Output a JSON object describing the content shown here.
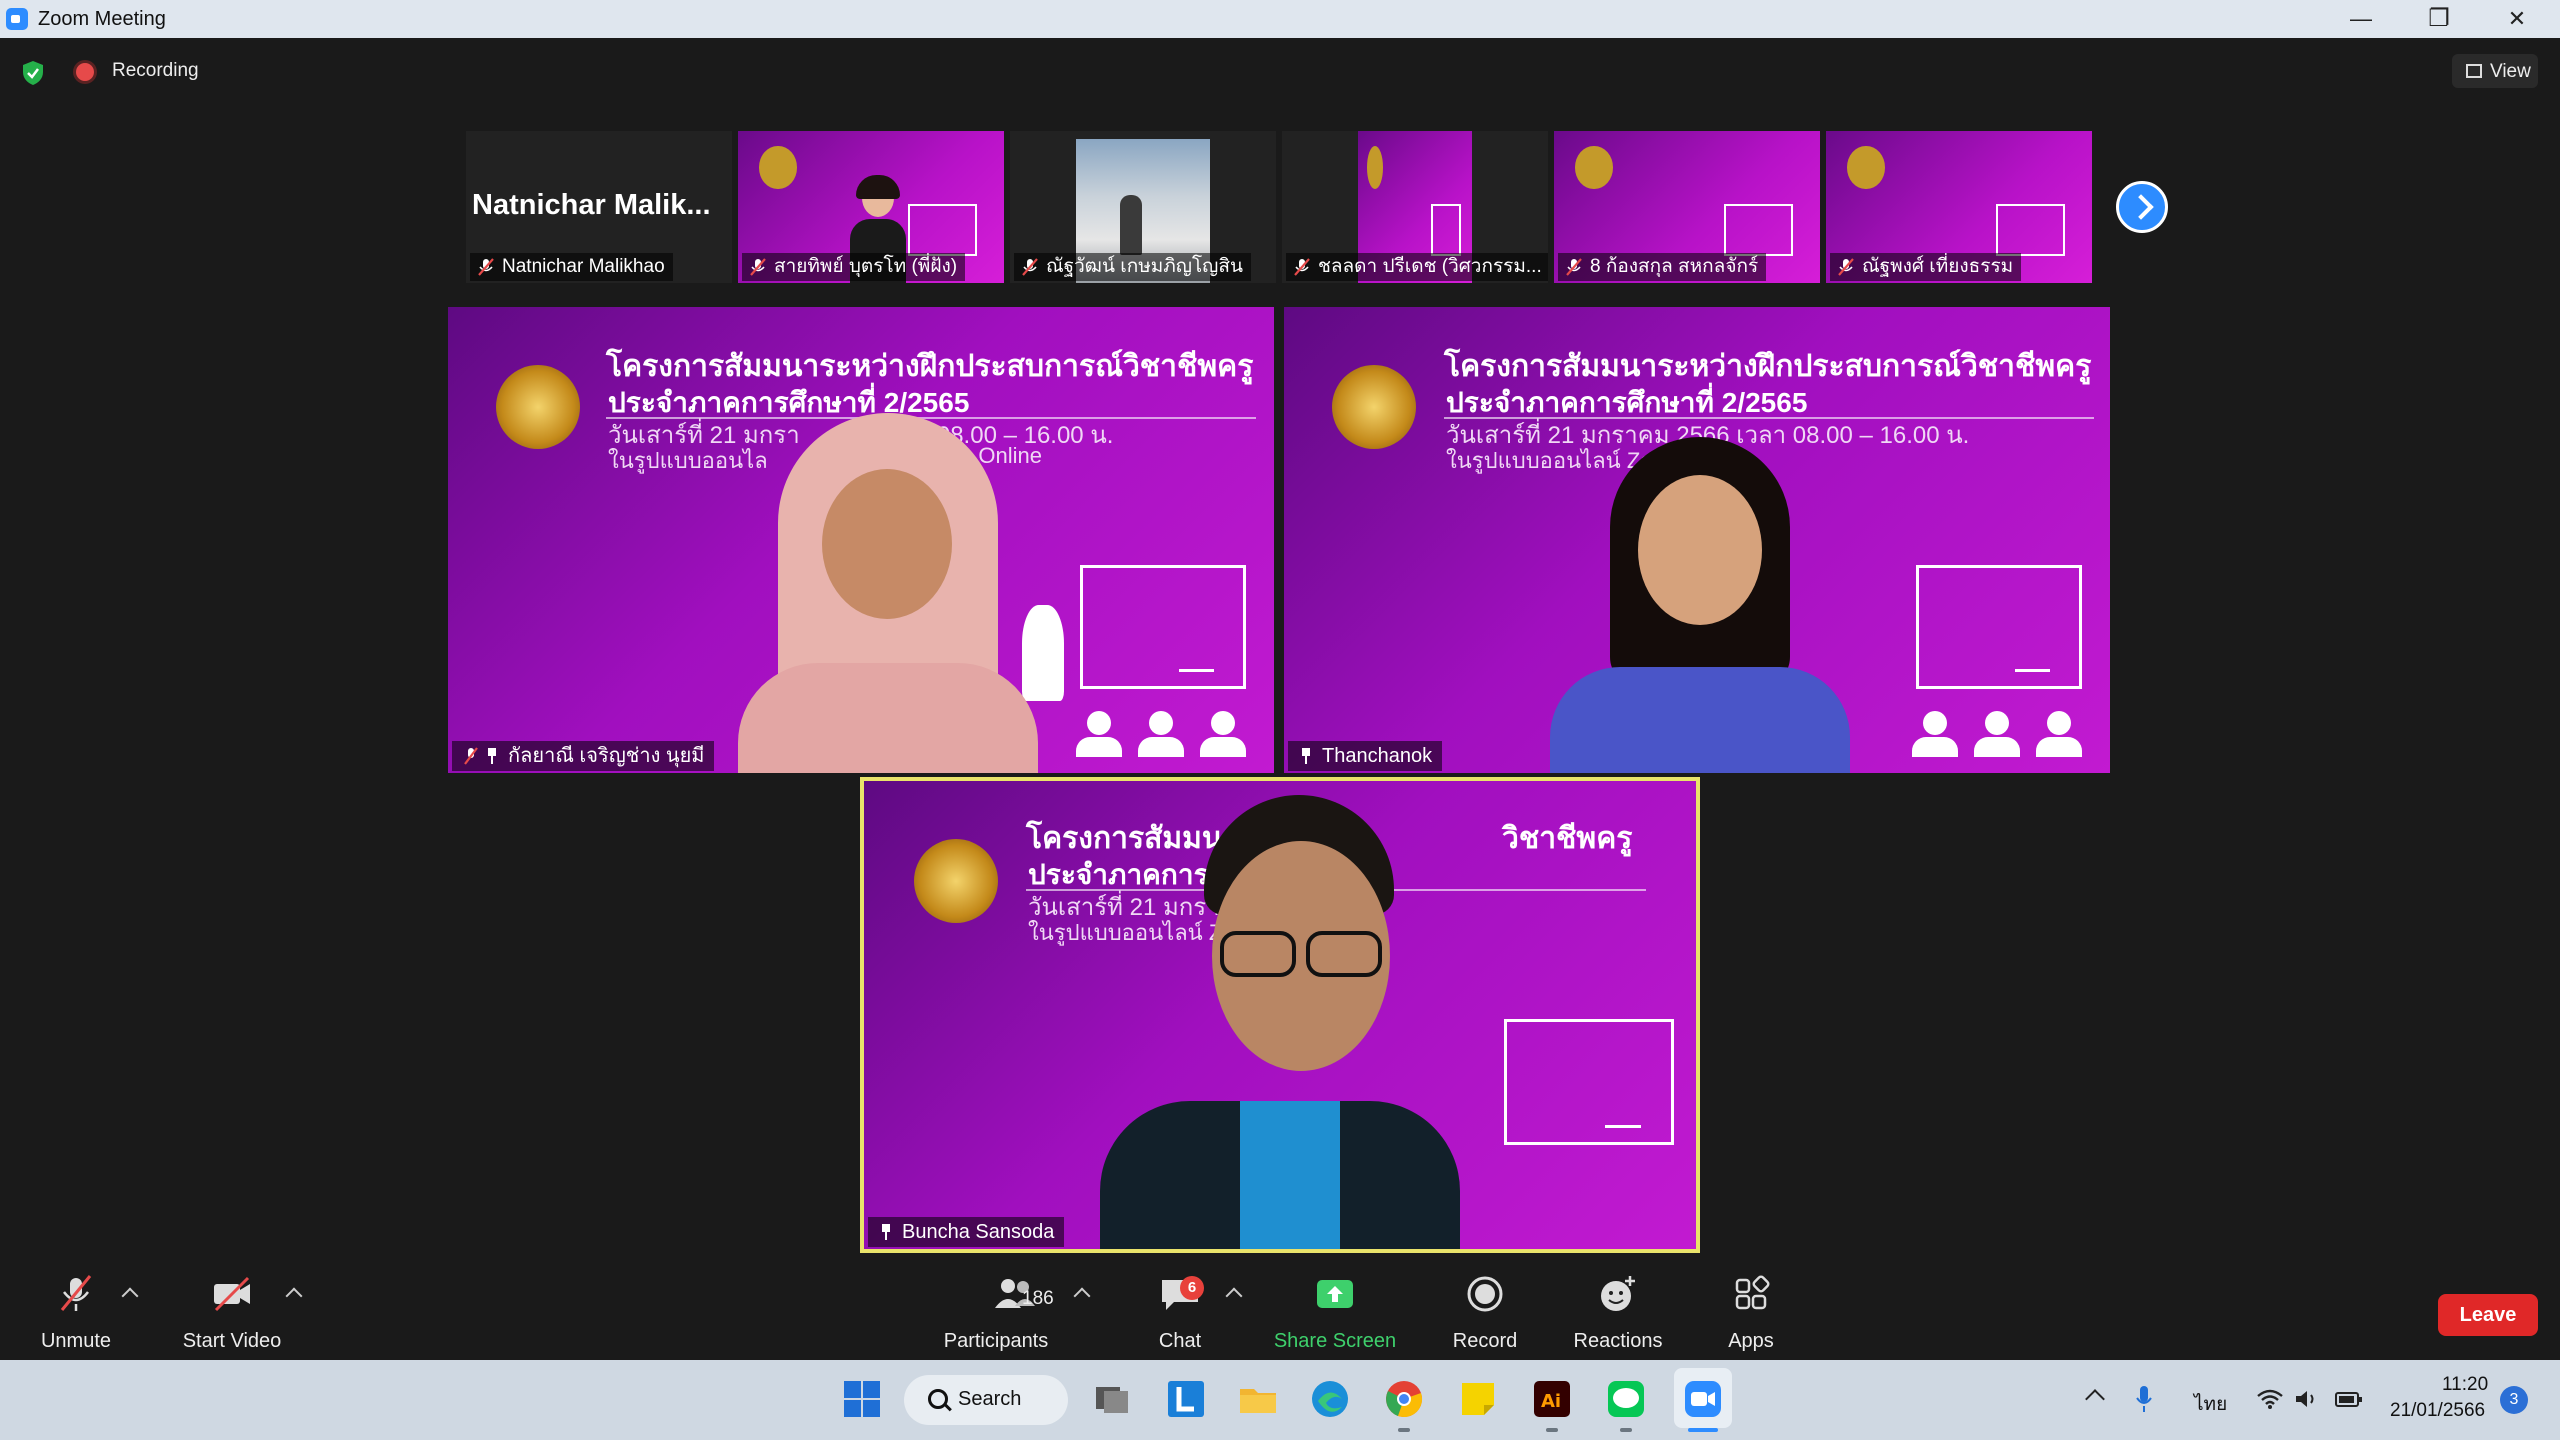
{
  "window": {
    "title": "Zoom Meeting",
    "minimize_glyph": "—",
    "restore_glyph": "❐",
    "close_glyph": "✕"
  },
  "topbar": {
    "security_icon": "shield-check-icon",
    "recording_label": "Recording",
    "view_label": "View"
  },
  "thumbnails": [
    {
      "big_name": "Natnichar  Malik...",
      "name": "Natnichar Malikhao",
      "muted": true,
      "video": "name-only"
    },
    {
      "name": "สายทิพย์ บุตรโท (พี่ฝัง)",
      "muted": true,
      "video": "slide-with-person"
    },
    {
      "name": "ณัฐวัฒน์ เกษมภิญโญสิน",
      "muted": true,
      "video": "outdoor"
    },
    {
      "name": "ชลลดา ปรีเดช (วิศวกรรม...",
      "muted": true,
      "video": "slide-partial"
    },
    {
      "name": "8 ก้องสกุล สหกลจักร์",
      "muted": true,
      "video": "slide"
    },
    {
      "name": "ณัฐพงศ์ เที่ยงธรรม",
      "muted": true,
      "video": "slide"
    }
  ],
  "slide": {
    "line1": "โครงการสัมมนาระหว่างฝึกประสบการณ์วิชาชีพครู",
    "line2": "ประจำภาคการศึกษาที่ 2/2565",
    "line3": "วันเสาร์ที่ 21 มกราคม 2566 เวลา 08.00 – 16.00 น.",
    "line4": "ในรูปแบบออนไลน์ Zoom Meeting Online",
    "left_line1": "โครงการสัมมนาระหว่างฝึกประสบการณ์วิชาชีพครู",
    "left_line2": "ประจำภาคการศึกษาที่ 2/2565",
    "left_line3": "วันเสาร์ที่ 21 มกรา",
    "left_line3b": "ลา 08.00 – 16.00 น.",
    "left_line4": "ในรูปแบบออนไล",
    "left_line4b": "g Online",
    "right_line4": "ในรูปแบบออนไลน์ Zoom Me",
    "bottom_line1a": "โครงการสัมมนาร",
    "bottom_line1b": "วิชาชีพครู",
    "bottom_line2": "ประจำภาคการศึ",
    "bottom_line3": "วันเสาร์ที่ 21 มกราคม",
    "bottom_line4": "ในรูปแบบออนไลน์ Zoo"
  },
  "tiles": {
    "left_name": "กัลยาณี เจริญช่าง นุยมี",
    "right_name": "Thanchanok",
    "bottom_name": "Buncha Sansoda"
  },
  "toolbar": {
    "unmute_label": "Unmute",
    "start_video_label": "Start Video",
    "participants_label": "Participants",
    "participants_count": "186",
    "chat_label": "Chat",
    "chat_badge": "6",
    "share_label": "Share Screen",
    "record_label": "Record",
    "reactions_label": "Reactions",
    "apps_label": "Apps",
    "leave_label": "Leave"
  },
  "taskbar": {
    "search_label": "Search",
    "language": "ไทย",
    "time": "11:20",
    "date": "21/01/2566",
    "notification_count": "3"
  },
  "colors": {
    "accent": "#2d8cff",
    "leave": "#e02828",
    "share_green": "#3ed06c",
    "active_speaker_border": "#e9e36a",
    "slide_magenta": "#b812c8"
  }
}
